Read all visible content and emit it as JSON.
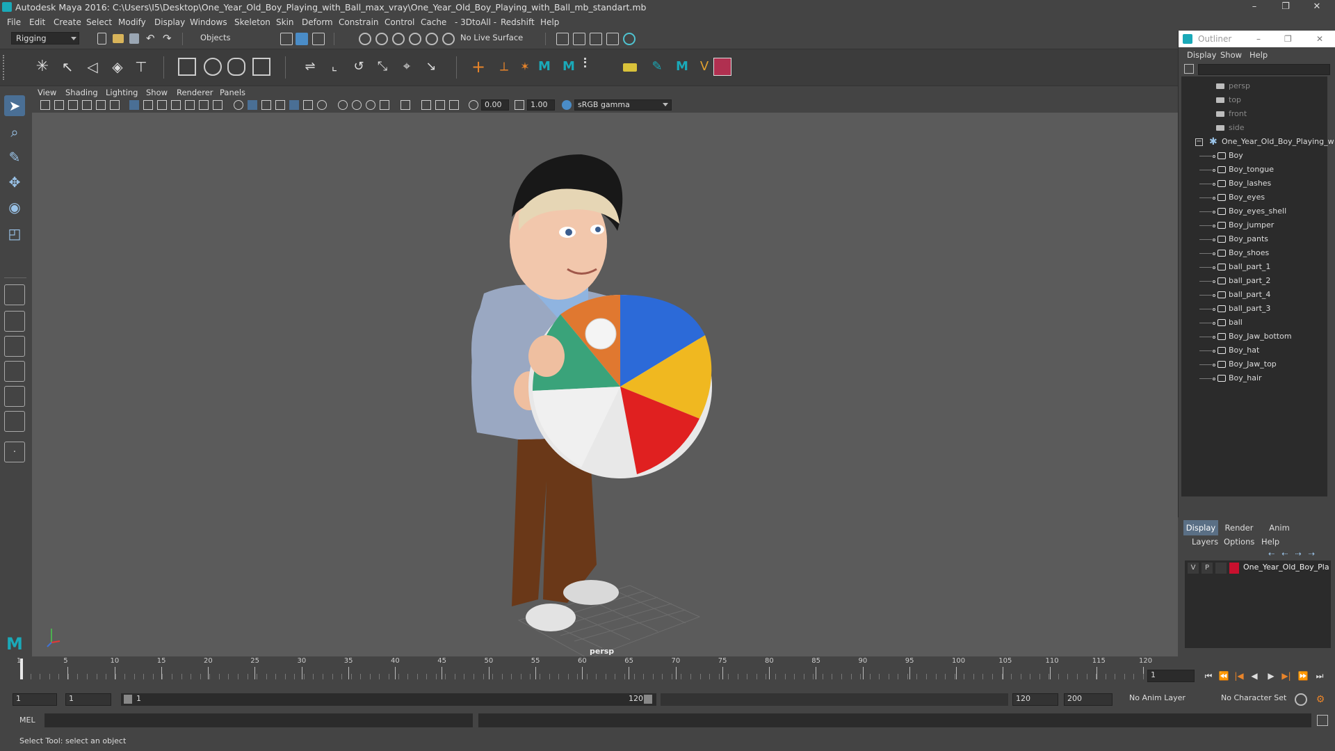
{
  "window": {
    "title": "Autodesk Maya 2016: C:\\Users\\I5\\Desktop\\One_Year_Old_Boy_Playing_with_Ball_max_vray\\One_Year_Old_Boy_Playing_with_Ball_mb_standart.mb",
    "minimize": "–",
    "maximize": "❐",
    "close": "✕"
  },
  "menubar": [
    "File",
    "Edit",
    "Create",
    "Select",
    "Modify",
    "Display",
    "Windows",
    "Skeleton",
    "Skin",
    "Deform",
    "Constrain",
    "Control",
    "Cache",
    "- 3DtoAll -",
    "Redshift",
    "Help"
  ],
  "statusline": {
    "mode": "Rigging",
    "select_mode": "Objects",
    "live_surface": "No Live Surface"
  },
  "panel": {
    "menu": [
      "View",
      "Shading",
      "Lighting",
      "Show",
      "Renderer",
      "Panels"
    ],
    "exposure": "0.00",
    "gamma": "1.00",
    "color_space": "sRGB gamma",
    "camera_label": "persp"
  },
  "outliner": {
    "title": "Outliner",
    "menu": [
      "Display",
      "Show",
      "Help"
    ],
    "cameras": [
      "persp",
      "top",
      "front",
      "side"
    ],
    "root": "One_Year_Old_Boy_Playing_w",
    "children": [
      "Boy",
      "Boy_tongue",
      "Boy_lashes",
      "Boy_eyes",
      "Boy_eyes_shell",
      "Boy_jumper",
      "Boy_pants",
      "Boy_shoes",
      "ball_part_1",
      "ball_part_2",
      "ball_part_4",
      "ball_part_3",
      "ball",
      "Boy_Jaw_bottom",
      "Boy_hat",
      "Boy_Jaw_top",
      "Boy_hair"
    ]
  },
  "layer_editor": {
    "tabs": [
      "Display",
      "Render",
      "Anim"
    ],
    "menu": [
      "Layers",
      "Options",
      "Help"
    ],
    "layer": {
      "v": "V",
      "p": "P",
      "name": "One_Year_Old_Boy_Pla",
      "color": "#c8102e"
    }
  },
  "timeline": {
    "ticks": [
      "1",
      "5",
      "10",
      "15",
      "20",
      "25",
      "30",
      "35",
      "40",
      "45",
      "50",
      "55",
      "60",
      "65",
      "70",
      "75",
      "80",
      "85",
      "90",
      "95",
      "100",
      "105",
      "110",
      "115",
      "120"
    ],
    "current_frame": "1"
  },
  "range": {
    "start": "1",
    "inner_start": "1",
    "slider_start": "1",
    "slider_end": "120",
    "end": "120",
    "outer_end": "200",
    "anim_layer": "No Anim Layer",
    "char_set": "No Character Set"
  },
  "cmdline": {
    "label": "MEL"
  },
  "helpline": {
    "text": "Select Tool: select an object"
  },
  "colors": {
    "accent_blue": "#4a8cc7",
    "viewport_bg": "#5b5b5b",
    "maya_teal": "#1aa9b8"
  }
}
